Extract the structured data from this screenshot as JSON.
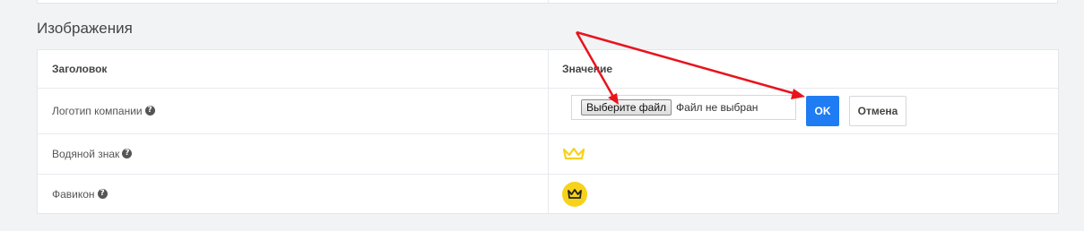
{
  "section": {
    "title": "Изображения"
  },
  "table": {
    "header": {
      "title_col": "Заголовок",
      "value_col": "Значение"
    },
    "rows": [
      {
        "label": "Логотип компании"
      },
      {
        "label": "Водяной знак"
      },
      {
        "label": "Фавикон"
      }
    ]
  },
  "file_input": {
    "button_label": "Выберите файл",
    "status": "Файл не выбран"
  },
  "actions": {
    "ok_label": "OK",
    "cancel_label": "Отмена"
  },
  "colors": {
    "accent": "#1f7cf2",
    "crown": "#f7d21a",
    "annotation_arrow": "#e8141c"
  },
  "icons": {
    "help": "question-circle-icon",
    "watermark": "crown-outline-icon",
    "favicon": "crown-circle-icon"
  }
}
